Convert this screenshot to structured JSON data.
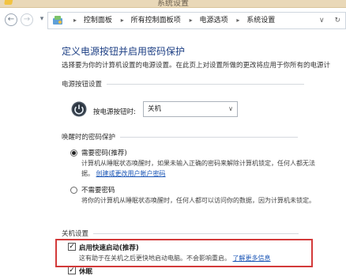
{
  "window": {
    "title": "系统设置"
  },
  "address": {
    "crumbs": [
      "控制面板",
      "所有控制面板项",
      "电源选项",
      "系统设置"
    ],
    "dropdown_glyph": "∨",
    "refresh_glyph": "↻"
  },
  "page": {
    "title": "定义电源按钮并启用密码保护",
    "intro": "选择要为你的计算机设置的电源设置。在此页上对设置所做的更改将应用于你所有的电源计"
  },
  "power_button": {
    "section": "电源按钮设置",
    "label": "按电源按钮时:",
    "value": "关机"
  },
  "wake": {
    "section": "唤醒时的密码保护",
    "require": {
      "title": "需要密码(推荐)",
      "desc_line1": "计算机从睡眠状态唤醒时，如果未输入正确的密码来解除计算机锁定，任何人都无法",
      "desc_line2_prefix": "据。",
      "link": "创建或更改用户帐户密码"
    },
    "no_require": {
      "title": "不需要密码",
      "desc": "将你的计算机从睡眠状态唤醒时，任何人都可以访问你的数据，因为计算机未锁定。"
    }
  },
  "shutdown": {
    "section": "关机设置",
    "fast_startup": {
      "title": "启用快速启动(推荐)",
      "desc": "这有助于在关机之后更快地启动电脑。不会影响重启。",
      "link": "了解更多信息"
    },
    "hibernate": {
      "title": "休眠"
    }
  },
  "colors": {
    "title_blue": "#1d3f84",
    "link_blue": "#1a55b6",
    "highlight_red": "#d33a3a"
  },
  "icons": [
    "back-arrow-icon",
    "forward-arrow-icon",
    "up-chevron-icon",
    "control-panel-icon",
    "power-icon",
    "dropdown-caret-icon",
    "refresh-icon"
  ]
}
